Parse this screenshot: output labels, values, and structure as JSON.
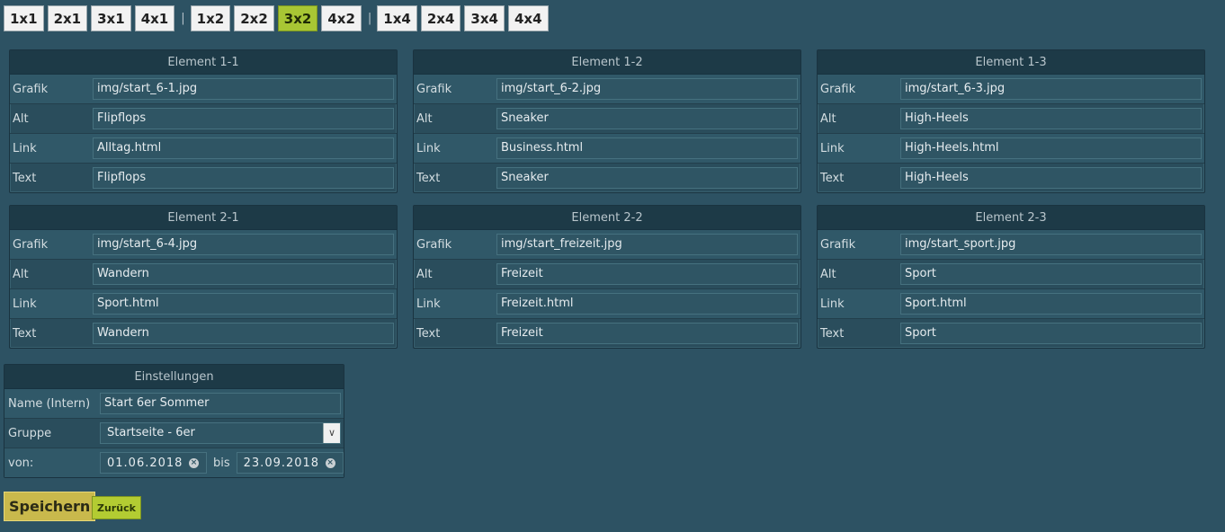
{
  "layout_buttons": {
    "group1": [
      "1x1",
      "2x1",
      "3x1",
      "4x1"
    ],
    "separator": "|",
    "group2": [
      "1x2",
      "2x2",
      "3x2",
      "4x2"
    ],
    "group3": [
      "1x4",
      "2x4",
      "3x4",
      "4x4"
    ],
    "active": "3x2"
  },
  "labels": {
    "grafik": "Grafik",
    "alt": "Alt",
    "link": "Link",
    "text": "Text"
  },
  "elements": [
    {
      "title": "Element 1-1",
      "grafik": "img/start_6-1.jpg",
      "alt": "Flipflops",
      "link": "Alltag.html",
      "text": "Flipflops"
    },
    {
      "title": "Element 1-2",
      "grafik": "img/start_6-2.jpg",
      "alt": "Sneaker",
      "link": "Business.html",
      "text": "Sneaker"
    },
    {
      "title": "Element 1-3",
      "grafik": "img/start_6-3.jpg",
      "alt": "High-Heels",
      "link": "High-Heels.html",
      "text": "High-Heels"
    },
    {
      "title": "Element 2-1",
      "grafik": "img/start_6-4.jpg",
      "alt": "Wandern",
      "link": "Sport.html",
      "text": "Wandern"
    },
    {
      "title": "Element 2-2",
      "grafik": "img/start_freizeit.jpg",
      "alt": "Freizeit",
      "link": "Freizeit.html",
      "text": "Freizeit"
    },
    {
      "title": "Element 2-3",
      "grafik": "img/start_sport.jpg",
      "alt": "Sport",
      "link": "Sport.html",
      "text": "Sport"
    }
  ],
  "settings": {
    "title": "Einstellungen",
    "name_label": "Name (Intern)",
    "name_value": "Start 6er Sommer",
    "group_label": "Gruppe",
    "group_value": "Startseite - 6er",
    "from_label": "von:",
    "from_value": "01.06.2018",
    "to_label": "bis",
    "to_value": "23.09.2018"
  },
  "actions": {
    "save": "Speichern",
    "back": "Zurück"
  },
  "icons": {
    "select_arrow": "chevron-down-icon",
    "clear": "clear-icon"
  },
  "colors": {
    "background": "#2d5263",
    "active_layout": "#a8c634",
    "save": "#c9b94c",
    "back": "#b3cc32"
  }
}
